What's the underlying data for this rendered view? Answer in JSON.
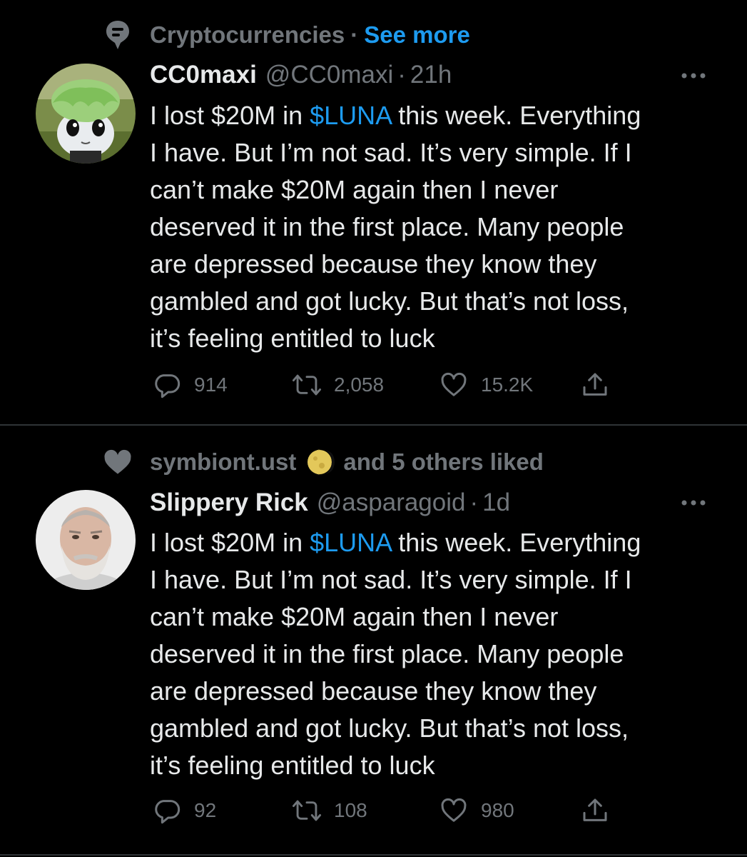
{
  "colors": {
    "background": "#000000",
    "primary_text": "#e7e9ea",
    "secondary_text": "#71767b",
    "accent": "#1d9bf0",
    "divider": "#2f3336"
  },
  "tweets": [
    {
      "context": {
        "icon": "topic-icon",
        "topic": "Cryptocurrencies",
        "separator": "·",
        "see_more": "See more"
      },
      "avatar": "avatar-green-haired-cartoon",
      "display_name": "CC0maxi",
      "handle": "@CC0maxi",
      "separator": "·",
      "time": "21h",
      "more_icon": "more-icon",
      "text": {
        "line1_before": "I lost $20M in ",
        "cashtag": "$LUNA",
        "line1_after": " this week. Everything",
        "line2": "I have. But I’m not sad. It’s very simple. If I",
        "line3": "can’t make $20M again then I never",
        "line4": "deserved it in the first place. Many people",
        "line5": "are depressed because they know they",
        "line6": "gambled and got lucky. But that’s not loss,",
        "line7": "it’s feeling entitled to luck"
      },
      "stats": {
        "replies": "914",
        "retweets": "2,058",
        "likes": "15.2K"
      }
    },
    {
      "context": {
        "icon": "heart-icon",
        "liker": "symbiont.ust",
        "liker_avatar": "moon-avatar",
        "others": "and 5 others liked"
      },
      "avatar": "avatar-bearded-man",
      "display_name": "Slippery Rick",
      "handle": "@asparagoid",
      "separator": "·",
      "time": "1d",
      "more_icon": "more-icon",
      "text": {
        "line1_before": "I lost $20M in ",
        "cashtag": "$LUNA",
        "line1_after": " this week. Everything",
        "line2": "I have. But I’m not sad. It’s very simple. If I",
        "line3": "can’t make $20M again then I never",
        "line4": "deserved it in the first place. Many people",
        "line5": "are depressed because they know they",
        "line6": "gambled and got lucky. But that’s not loss,",
        "line7": "it’s feeling entitled to luck"
      },
      "stats": {
        "replies": "92",
        "retweets": "108",
        "likes": "980"
      }
    }
  ]
}
